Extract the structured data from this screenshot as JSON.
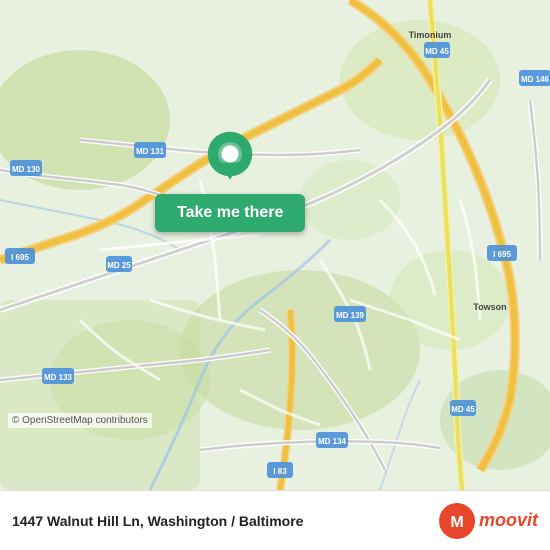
{
  "map": {
    "attribution": "© OpenStreetMap contributors",
    "background_color": "#e8f0e0"
  },
  "popup": {
    "button_label": "Take me there",
    "button_color": "#2eaa6e"
  },
  "info_bar": {
    "address": "1447 Walnut Hill Ln, Washington / Baltimore"
  },
  "moovit": {
    "text": "moovit",
    "icon": "moovit-logo-icon"
  },
  "road_labels": [
    {
      "id": "md25",
      "text": "MD 25"
    },
    {
      "id": "md131",
      "text": "MD 131"
    },
    {
      "id": "md130",
      "text": "MD 130"
    },
    {
      "id": "md45a",
      "text": "MD 45"
    },
    {
      "id": "md45b",
      "text": "MD 45"
    },
    {
      "id": "i695a",
      "text": "I 695"
    },
    {
      "id": "i695b",
      "text": "I 695"
    },
    {
      "id": "md133",
      "text": "MD 133"
    },
    {
      "id": "md139",
      "text": "MD 139"
    },
    {
      "id": "md134",
      "text": "MD 134"
    },
    {
      "id": "i83",
      "text": "I 83"
    },
    {
      "id": "md146",
      "text": "MD 146"
    },
    {
      "id": "timonium",
      "text": "Timonium"
    },
    {
      "id": "towson",
      "text": "Towson"
    }
  ]
}
